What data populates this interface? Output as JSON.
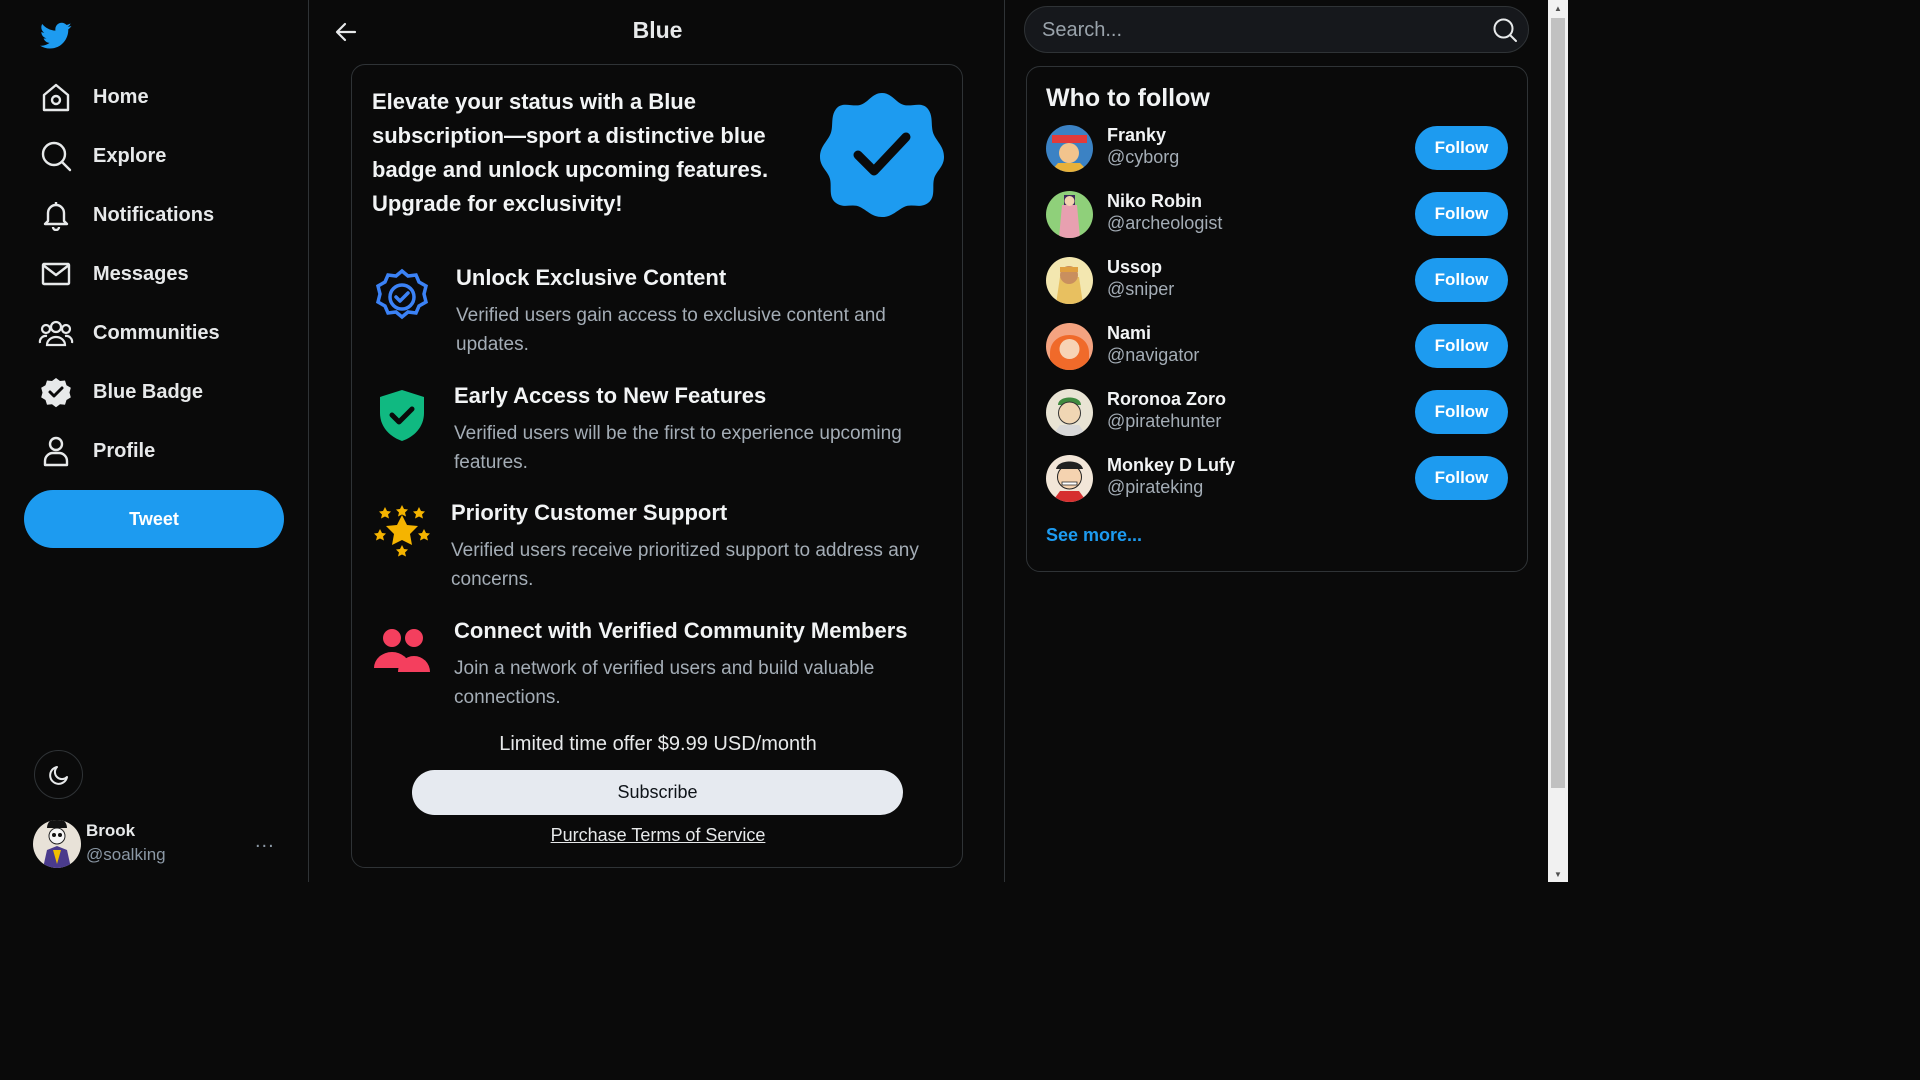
{
  "sidebar": {
    "nav": [
      {
        "label": "Home",
        "icon": "home-icon"
      },
      {
        "label": "Explore",
        "icon": "search-icon"
      },
      {
        "label": "Notifications",
        "icon": "bell-icon"
      },
      {
        "label": "Messages",
        "icon": "mail-icon"
      },
      {
        "label": "Communities",
        "icon": "people-icon"
      },
      {
        "label": "Blue Badge",
        "icon": "verified-badge-icon"
      },
      {
        "label": "Profile",
        "icon": "user-icon"
      }
    ],
    "tweet_label": "Tweet",
    "account": {
      "name": "Brook",
      "handle": "@soalking",
      "more": "..."
    }
  },
  "main": {
    "title": "Blue",
    "hero_text": "Elevate your status with a Blue subscription—sport a distinctive blue badge and unlock upcoming features. Upgrade for exclusivity!",
    "features": [
      {
        "title": "Unlock Exclusive Content",
        "desc": "Verified users gain access to exclusive content and updates.",
        "icon": "verified-outline-icon"
      },
      {
        "title": "Early Access to New Features",
        "desc": "Verified users will be the first to experience upcoming features.",
        "icon": "shield-check-icon"
      },
      {
        "title": "Priority Customer Support",
        "desc": "Verified users receive prioritized support to address any concerns.",
        "icon": "stars-icon"
      },
      {
        "title": "Connect with Verified Community Members",
        "desc": "Join a network of verified users and build valuable connections.",
        "icon": "community-icon"
      }
    ],
    "offer": "Limited time offer $9.99 USD/month",
    "subscribe_label": "Subscribe",
    "terms_label": "Purchase Terms of Service"
  },
  "right": {
    "search_placeholder": "Search...",
    "who_to_follow": {
      "title": "Who to follow",
      "users": [
        {
          "name": "Franky",
          "handle": "@cyborg",
          "follow": "Follow"
        },
        {
          "name": "Niko Robin",
          "handle": "@archeologist",
          "follow": "Follow"
        },
        {
          "name": "Ussop",
          "handle": "@sniper",
          "follow": "Follow"
        },
        {
          "name": "Nami",
          "handle": "@navigator",
          "follow": "Follow"
        },
        {
          "name": "Roronoa Zoro",
          "handle": "@piratehunter",
          "follow": "Follow"
        },
        {
          "name": "Monkey D Lufy",
          "handle": "@pirateking",
          "follow": "Follow"
        }
      ],
      "see_more": "See more..."
    }
  },
  "colors": {
    "accent": "#1d9bf0",
    "background": "#0a0a0a",
    "border": "#2f3336",
    "shield": "#10b981",
    "stars": "#f5b400",
    "community": "#f43f5e"
  }
}
